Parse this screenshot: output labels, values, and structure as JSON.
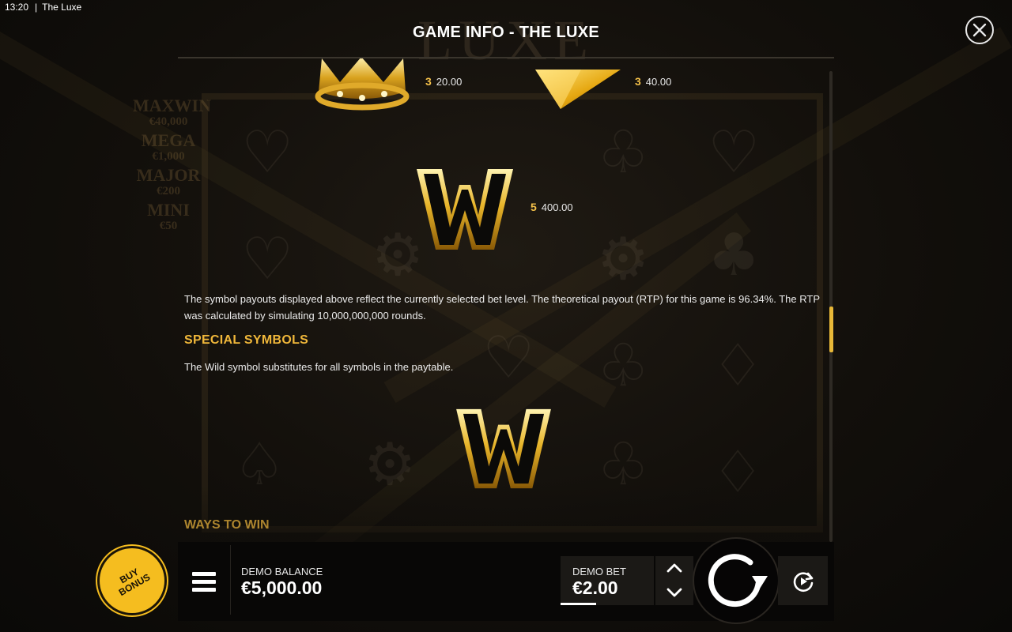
{
  "status_bar": {
    "time": "13:20",
    "app_name": "The Luxe"
  },
  "panel": {
    "title": "GAME INFO - THE LUXE",
    "close_icon": "close-icon"
  },
  "paytable": {
    "crown_payout": {
      "count": "3",
      "amount": "20.00"
    },
    "diamond_payout": {
      "count": "3",
      "amount": "40.00"
    },
    "wild_payout": {
      "count": "5",
      "amount": "400.00"
    }
  },
  "rtp_text": "The symbol payouts displayed above reflect the currently selected bet level. The theoretical payout (RTP) for this game is 96.34%. The RTP was calculated by simulating 10,000,000,000 rounds.",
  "special_symbols": {
    "heading": "SPECIAL SYMBOLS",
    "wild_text": "The Wild symbol substitutes for all symbols in the paytable."
  },
  "ways_heading": "WAYS TO WIN",
  "bottom_bar": {
    "buy_bonus_label": "BUY\nBONUS",
    "balance_label": "DEMO BALANCE",
    "balance_value": "€5,000.00",
    "bet_label": "DEMO BET",
    "bet_value": "€2.00",
    "icons": [
      "menu-icon",
      "chevron-up-icon",
      "chevron-down-icon",
      "spin-icon",
      "autoplay-icon"
    ]
  },
  "colors": {
    "accent_gold": "#f0b73a",
    "buy_bonus_yellow": "#f5bd1f",
    "background": "#0f0d0a"
  }
}
